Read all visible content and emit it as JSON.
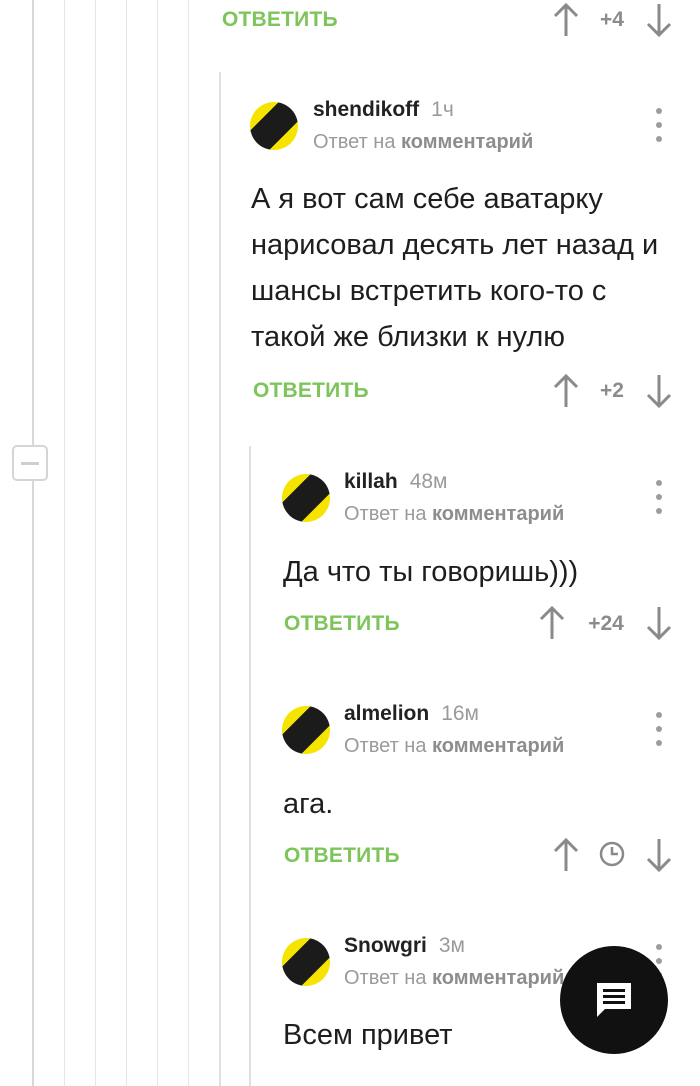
{
  "top": {
    "reply_label": "ОТВЕТИТЬ",
    "score": "+4"
  },
  "comments": [
    {
      "author": "shendikoff",
      "time": "1ч",
      "reply_prefix": "Ответ на",
      "reply_link": "комментарий",
      "text": "А я вот сам себе аватарку нарисовал десять лет назад и шансы встретить кого-то с такой же близки к нулю",
      "reply_label": "ОТВЕТИТЬ",
      "score": "+2"
    },
    {
      "author": "killah",
      "time": "48м",
      "reply_prefix": "Ответ на",
      "reply_link": "комментарий",
      "text": "Да что ты говоришь)))",
      "reply_label": "ОТВЕТИТЬ",
      "score": "+24"
    },
    {
      "author": "almelion",
      "time": "16м",
      "reply_prefix": "Ответ на",
      "reply_link": "комментарий",
      "text": "ага.",
      "reply_label": "ОТВЕТИТЬ",
      "score_icon": "clock-icon"
    },
    {
      "author": "Snowgri",
      "time": "3м",
      "reply_prefix": "Ответ на",
      "reply_link": "комментарий",
      "text": "Всем привет"
    }
  ],
  "colors": {
    "accent_green": "#7dc45a",
    "fab_bg": "#111111"
  },
  "icons": {
    "vote_up": "arrow-up-icon",
    "vote_down": "arrow-down-icon",
    "menu": "kebab-menu-icon",
    "fab": "comment-icon",
    "collapse": "minus-icon"
  }
}
